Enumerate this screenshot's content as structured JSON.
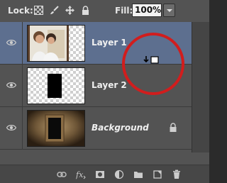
{
  "topbar": {
    "lock_label": "Lock:",
    "fill_label": "Fill:",
    "fill_value": "100%"
  },
  "layers": [
    {
      "name": "Layer 1",
      "selected": true,
      "locked": false,
      "italic": false,
      "visible": true
    },
    {
      "name": "Layer 2",
      "selected": false,
      "locked": false,
      "italic": false,
      "visible": true
    },
    {
      "name": "Background",
      "selected": false,
      "locked": true,
      "italic": true,
      "visible": true
    }
  ],
  "bottom_icons": [
    "link-icon",
    "fx-icon",
    "layer-mask-icon",
    "adjustment-layer-icon",
    "folder-icon",
    "new-layer-icon",
    "trash-icon"
  ],
  "colors": {
    "panel_bg": "#535353",
    "selected_row": "#5d6f8f",
    "annotation_circle": "#d11d1d"
  }
}
